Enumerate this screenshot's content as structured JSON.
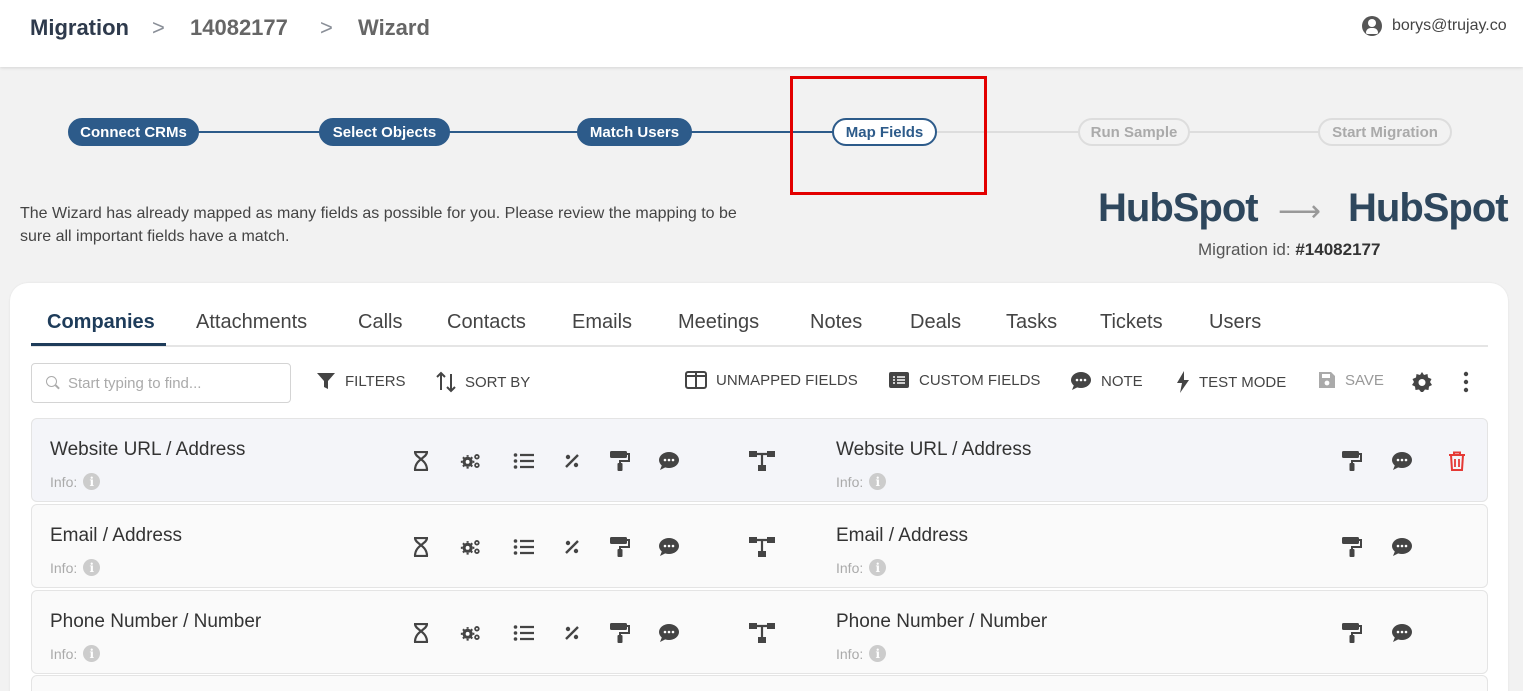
{
  "breadcrumb": {
    "items": [
      "Migration",
      "14082177",
      "Wizard"
    ],
    "separator": ">"
  },
  "user": {
    "email": "borys@trujay.co"
  },
  "stepper": {
    "steps": [
      {
        "label": "Connect CRMs",
        "state": "done"
      },
      {
        "label": "Select Objects",
        "state": "done"
      },
      {
        "label": "Match Users",
        "state": "done"
      },
      {
        "label": "Map Fields",
        "state": "active"
      },
      {
        "label": "Run Sample",
        "state": "todo"
      },
      {
        "label": "Start Migration",
        "state": "todo"
      }
    ]
  },
  "intro": "The Wizard has already mapped as many fields as possible for you. Please review the mapping to be sure all important fields have a match.",
  "logos": {
    "source": "HubSpot",
    "target": "HubSpot"
  },
  "migration_id": {
    "label": "Migration id:",
    "value": "#14082177"
  },
  "tabs": [
    "Companies",
    "Attachments",
    "Calls",
    "Contacts",
    "Emails",
    "Meetings",
    "Notes",
    "Deals",
    "Tasks",
    "Tickets",
    "Users"
  ],
  "active_tab": "Companies",
  "search": {
    "placeholder": "Start typing to find..."
  },
  "toolbar": {
    "filters": "FILTERS",
    "sort_by": "SORT BY",
    "unmapped_fields": "UNMAPPED FIELDS",
    "custom_fields": "CUSTOM FIELDS",
    "note": "NOTE",
    "test_mode": "TEST MODE",
    "save": "SAVE"
  },
  "rows": [
    {
      "source": "Website URL / Address",
      "target": "Website URL / Address",
      "info_label": "Info:",
      "has_delete": true
    },
    {
      "source": "Email / Address",
      "target": "Email / Address",
      "info_label": "Info:",
      "has_delete": false
    },
    {
      "source": "Phone Number / Number",
      "target": "Phone Number / Number",
      "info_label": "Info:",
      "has_delete": false
    }
  ],
  "colors": {
    "primary": "#2d5b8a",
    "accent": "#ff7a59",
    "highlight": "#e30000",
    "delete": "#e53935"
  }
}
